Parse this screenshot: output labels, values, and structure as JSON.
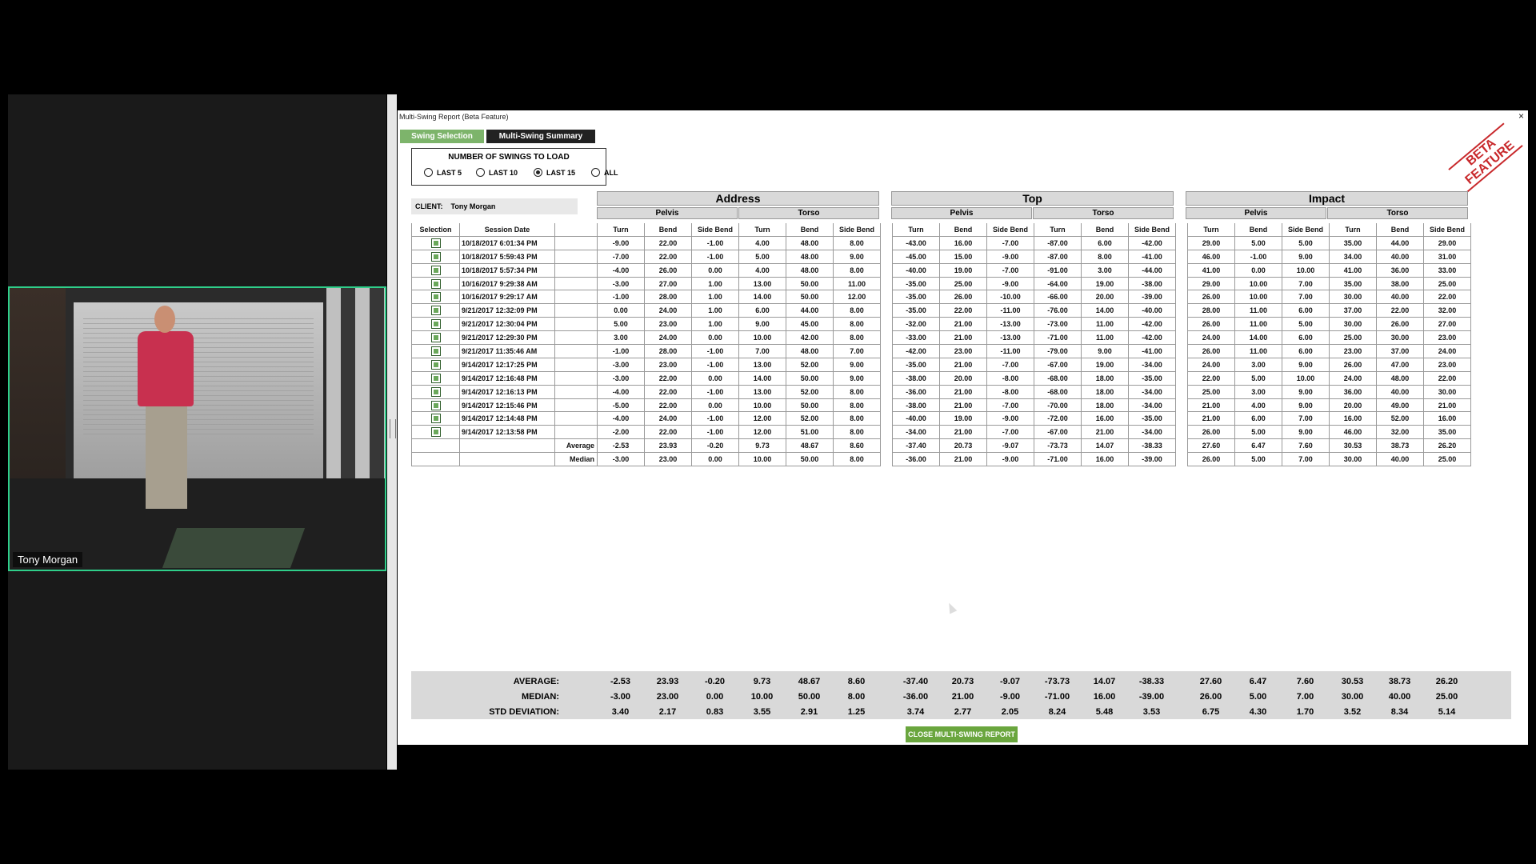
{
  "participant": {
    "name": "Tony Morgan"
  },
  "window": {
    "title": "Multi-Swing Report (Beta Feature)",
    "close_glyph": "×"
  },
  "tabs": [
    {
      "label": "Swing Selection"
    },
    {
      "label": "Multi-Swing Summary"
    }
  ],
  "beta_badge": [
    "BETA",
    "FEATURE"
  ],
  "load_box": {
    "title": "NUMBER OF SWINGS TO LOAD",
    "options": [
      {
        "label": "LAST 5"
      },
      {
        "label": "LAST 10"
      },
      {
        "label": "LAST 15"
      },
      {
        "label": "ALL"
      }
    ],
    "selected": "LAST 15"
  },
  "client": {
    "label": "CLIENT:",
    "name": "Tony Morgan"
  },
  "phases": [
    "Address",
    "Top",
    "Impact"
  ],
  "segments": [
    "Pelvis",
    "Torso"
  ],
  "columns": {
    "selection": "Selection",
    "session_date": "Session Date",
    "metrics": [
      "Turn",
      "Bend",
      "Side Bend",
      "Turn",
      "Bend",
      "Side Bend",
      "Turn",
      "Bend",
      "Side Bend",
      "Turn",
      "Bend",
      "Side Bend",
      "Turn",
      "Bend",
      "Side Bend",
      "Turn",
      "Bend",
      "Side Bend"
    ]
  },
  "rows": [
    {
      "date": "10/18/2017 6:01:34 PM",
      "values": [
        "-9.00",
        "22.00",
        "-1.00",
        "4.00",
        "48.00",
        "8.00",
        "-43.00",
        "16.00",
        "-7.00",
        "-87.00",
        "6.00",
        "-42.00",
        "29.00",
        "5.00",
        "5.00",
        "35.00",
        "44.00",
        "29.00"
      ]
    },
    {
      "date": "10/18/2017 5:59:43 PM",
      "values": [
        "-7.00",
        "22.00",
        "-1.00",
        "5.00",
        "48.00",
        "9.00",
        "-45.00",
        "15.00",
        "-9.00",
        "-87.00",
        "8.00",
        "-41.00",
        "46.00",
        "-1.00",
        "9.00",
        "34.00",
        "40.00",
        "31.00"
      ]
    },
    {
      "date": "10/18/2017 5:57:34 PM",
      "values": [
        "-4.00",
        "26.00",
        "0.00",
        "4.00",
        "48.00",
        "8.00",
        "-40.00",
        "19.00",
        "-7.00",
        "-91.00",
        "3.00",
        "-44.00",
        "41.00",
        "0.00",
        "10.00",
        "41.00",
        "36.00",
        "33.00"
      ]
    },
    {
      "date": "10/16/2017 9:29:38 AM",
      "values": [
        "-3.00",
        "27.00",
        "1.00",
        "13.00",
        "50.00",
        "11.00",
        "-35.00",
        "25.00",
        "-9.00",
        "-64.00",
        "19.00",
        "-38.00",
        "29.00",
        "10.00",
        "7.00",
        "35.00",
        "38.00",
        "25.00"
      ]
    },
    {
      "date": "10/16/2017 9:29:17 AM",
      "values": [
        "-1.00",
        "28.00",
        "1.00",
        "14.00",
        "50.00",
        "12.00",
        "-35.00",
        "26.00",
        "-10.00",
        "-66.00",
        "20.00",
        "-39.00",
        "26.00",
        "10.00",
        "7.00",
        "30.00",
        "40.00",
        "22.00"
      ]
    },
    {
      "date": "9/21/2017 12:32:09 PM",
      "values": [
        "0.00",
        "24.00",
        "1.00",
        "6.00",
        "44.00",
        "8.00",
        "-35.00",
        "22.00",
        "-11.00",
        "-76.00",
        "14.00",
        "-40.00",
        "28.00",
        "11.00",
        "6.00",
        "37.00",
        "22.00",
        "32.00"
      ]
    },
    {
      "date": "9/21/2017 12:30:04 PM",
      "values": [
        "5.00",
        "23.00",
        "1.00",
        "9.00",
        "45.00",
        "8.00",
        "-32.00",
        "21.00",
        "-13.00",
        "-73.00",
        "11.00",
        "-42.00",
        "26.00",
        "11.00",
        "5.00",
        "30.00",
        "26.00",
        "27.00"
      ]
    },
    {
      "date": "9/21/2017 12:29:30 PM",
      "values": [
        "3.00",
        "24.00",
        "0.00",
        "10.00",
        "42.00",
        "8.00",
        "-33.00",
        "21.00",
        "-13.00",
        "-71.00",
        "11.00",
        "-42.00",
        "24.00",
        "14.00",
        "6.00",
        "25.00",
        "30.00",
        "23.00"
      ]
    },
    {
      "date": "9/21/2017 11:35:46 AM",
      "values": [
        "-1.00",
        "28.00",
        "-1.00",
        "7.00",
        "48.00",
        "7.00",
        "-42.00",
        "23.00",
        "-11.00",
        "-79.00",
        "9.00",
        "-41.00",
        "26.00",
        "11.00",
        "6.00",
        "23.00",
        "37.00",
        "24.00"
      ]
    },
    {
      "date": "9/14/2017 12:17:25 PM",
      "values": [
        "-3.00",
        "23.00",
        "-1.00",
        "13.00",
        "52.00",
        "9.00",
        "-35.00",
        "21.00",
        "-7.00",
        "-67.00",
        "19.00",
        "-34.00",
        "24.00",
        "3.00",
        "9.00",
        "26.00",
        "47.00",
        "23.00"
      ]
    },
    {
      "date": "9/14/2017 12:16:48 PM",
      "values": [
        "-3.00",
        "22.00",
        "0.00",
        "14.00",
        "50.00",
        "9.00",
        "-38.00",
        "20.00",
        "-8.00",
        "-68.00",
        "18.00",
        "-35.00",
        "22.00",
        "5.00",
        "10.00",
        "24.00",
        "48.00",
        "22.00"
      ]
    },
    {
      "date": "9/14/2017 12:16:13 PM",
      "values": [
        "-4.00",
        "22.00",
        "-1.00",
        "13.00",
        "52.00",
        "8.00",
        "-36.00",
        "21.00",
        "-8.00",
        "-68.00",
        "18.00",
        "-34.00",
        "25.00",
        "3.00",
        "9.00",
        "36.00",
        "40.00",
        "30.00"
      ]
    },
    {
      "date": "9/14/2017 12:15:46 PM",
      "values": [
        "-5.00",
        "22.00",
        "0.00",
        "10.00",
        "50.00",
        "8.00",
        "-38.00",
        "21.00",
        "-7.00",
        "-70.00",
        "18.00",
        "-34.00",
        "21.00",
        "4.00",
        "9.00",
        "20.00",
        "49.00",
        "21.00"
      ]
    },
    {
      "date": "9/14/2017 12:14:48 PM",
      "values": [
        "-4.00",
        "24.00",
        "-1.00",
        "12.00",
        "52.00",
        "8.00",
        "-40.00",
        "19.00",
        "-9.00",
        "-72.00",
        "16.00",
        "-35.00",
        "21.00",
        "6.00",
        "7.00",
        "16.00",
        "52.00",
        "16.00"
      ]
    },
    {
      "date": "9/14/2017 12:13:58 PM",
      "values": [
        "-2.00",
        "22.00",
        "-1.00",
        "12.00",
        "51.00",
        "8.00",
        "-34.00",
        "21.00",
        "-7.00",
        "-67.00",
        "21.00",
        "-34.00",
        "26.00",
        "5.00",
        "9.00",
        "46.00",
        "32.00",
        "35.00"
      ]
    }
  ],
  "table_stats": [
    {
      "label": "Average",
      "values": [
        "-2.53",
        "23.93",
        "-0.20",
        "9.73",
        "48.67",
        "8.60",
        "-37.40",
        "20.73",
        "-9.07",
        "-73.73",
        "14.07",
        "-38.33",
        "27.60",
        "6.47",
        "7.60",
        "30.53",
        "38.73",
        "26.20"
      ]
    },
    {
      "label": "Median",
      "values": [
        "-3.00",
        "23.00",
        "0.00",
        "10.00",
        "50.00",
        "8.00",
        "-36.00",
        "21.00",
        "-9.00",
        "-71.00",
        "16.00",
        "-39.00",
        "26.00",
        "5.00",
        "7.00",
        "30.00",
        "40.00",
        "25.00"
      ]
    }
  ],
  "summary": [
    {
      "label": "AVERAGE:",
      "values": [
        "-2.53",
        "23.93",
        "-0.20",
        "9.73",
        "48.67",
        "8.60",
        "-37.40",
        "20.73",
        "-9.07",
        "-73.73",
        "14.07",
        "-38.33",
        "27.60",
        "6.47",
        "7.60",
        "30.53",
        "38.73",
        "26.20"
      ]
    },
    {
      "label": "MEDIAN:",
      "values": [
        "-3.00",
        "23.00",
        "0.00",
        "10.00",
        "50.00",
        "8.00",
        "-36.00",
        "21.00",
        "-9.00",
        "-71.00",
        "16.00",
        "-39.00",
        "26.00",
        "5.00",
        "7.00",
        "30.00",
        "40.00",
        "25.00"
      ]
    },
    {
      "label": "STD DEVIATION:",
      "values": [
        "3.40",
        "2.17",
        "0.83",
        "3.55",
        "2.91",
        "1.25",
        "3.74",
        "2.77",
        "2.05",
        "8.24",
        "5.48",
        "3.53",
        "6.75",
        "4.30",
        "1.70",
        "3.52",
        "8.34",
        "5.14"
      ]
    }
  ],
  "close_button": {
    "label": "CLOSE MULTI-SWING REPORT"
  }
}
